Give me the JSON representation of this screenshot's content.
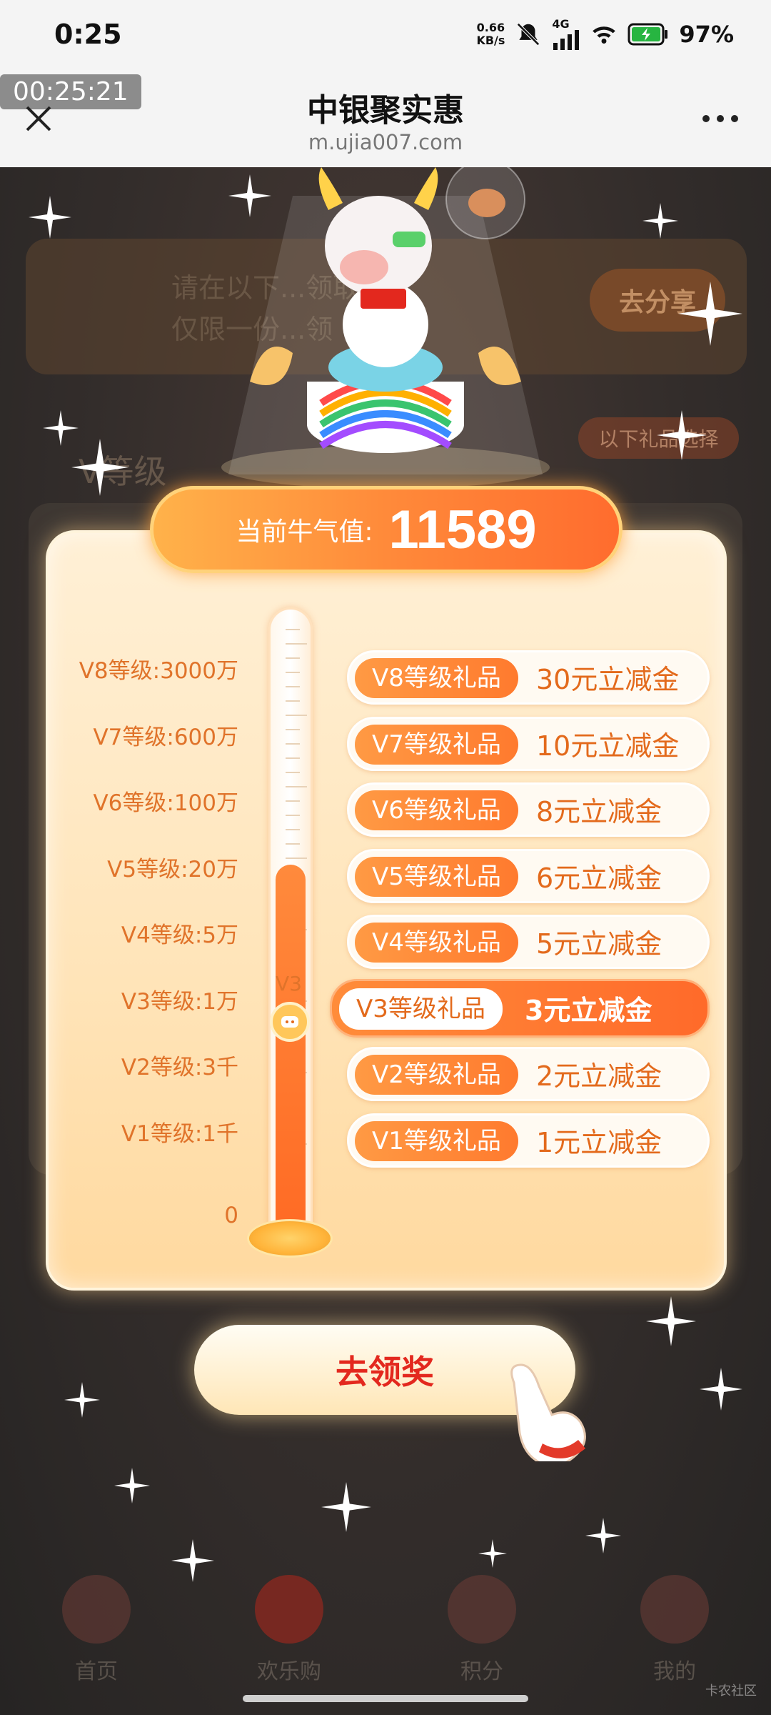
{
  "status_bar": {
    "time": "0:25",
    "net_speed_value": "0.66",
    "net_speed_unit": "KB/s",
    "network": "4G",
    "battery": "97%"
  },
  "browser": {
    "timer": "00:25:21",
    "title": "中银聚实惠",
    "url": "m.ujia007.com"
  },
  "background": {
    "banner_text_line1": "请在以下...领取",
    "banner_text_line2": "仅限一份...领",
    "share_button": "去分享",
    "section_title": "V等级",
    "gift_button": "以下礼品选择"
  },
  "score": {
    "label": "当前牛气值:",
    "value": "11589"
  },
  "levels": [
    {
      "label": "V8等级:3000万",
      "tag": "V8等级礼品",
      "reward": "30元立减金"
    },
    {
      "label": "V7等级:600万",
      "tag": "V7等级礼品",
      "reward": "10元立减金"
    },
    {
      "label": "V6等级:100万",
      "tag": "V6等级礼品",
      "reward": "8元立减金"
    },
    {
      "label": "V5等级:20万",
      "tag": "V5等级礼品",
      "reward": "6元立减金"
    },
    {
      "label": "V4等级:5万",
      "tag": "V4等级礼品",
      "reward": "5元立减金"
    },
    {
      "label": "V3等级:1万",
      "tag": "V3等级礼品",
      "reward": "3元立减金"
    },
    {
      "label": "V2等级:3千",
      "tag": "V2等级礼品",
      "reward": "2元立减金"
    },
    {
      "label": "V1等级:1千",
      "tag": "V1等级礼品",
      "reward": "1元立减金"
    }
  ],
  "zero_label": "0",
  "current_level": "V3",
  "current_level_index": 5,
  "progress_fraction": 0.6,
  "claim_button": "去领奖",
  "bottom_nav": [
    "首页",
    "欢乐购",
    "积分",
    "我的"
  ],
  "watermark": "卡农社区",
  "colors": {
    "accent": "#ff7a2e",
    "reward_text": "#e36a1c",
    "claim_text": "#e3281e"
  }
}
